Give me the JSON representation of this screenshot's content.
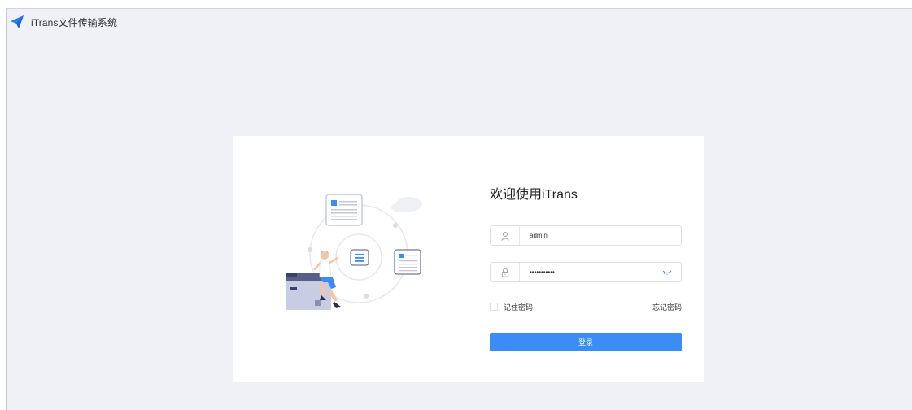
{
  "app": {
    "title": "iTrans文件传输系统",
    "logo_icon": "paper-plane-logo"
  },
  "login": {
    "welcome": "欢迎使用iTrans",
    "username_value": "admin",
    "password_value": "•••••••••••",
    "remember_label": "记住密码",
    "forgot_label": "忘记密码",
    "submit_label": "登录",
    "user_icon": "user-icon",
    "lock_icon": "lock-icon",
    "eye_icon": "eye-closed-icon"
  },
  "colors": {
    "background": "#f0f1f6",
    "card": "#ffffff",
    "accent": "#3c8cf5",
    "logo": "#2a7bf0"
  }
}
